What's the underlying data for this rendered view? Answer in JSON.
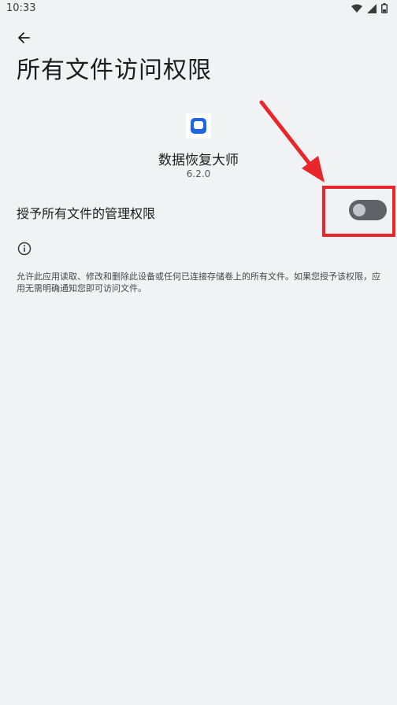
{
  "status_bar": {
    "time": "10:33"
  },
  "header": {
    "title": "所有文件访问权限"
  },
  "app": {
    "name": "数据恢复大师",
    "version": "6.2.0"
  },
  "permission": {
    "label": "授予所有文件的管理权限",
    "enabled": false
  },
  "info": {
    "description": "允许此应用读取、修改和删除此设备或任何已连接存储卷上的所有文件。如果您授予该权限，应用无需明确通知您即可访问文件。"
  },
  "colors": {
    "background": "#f1f2f4",
    "toggle_track_off": "#5f6368",
    "annotation_red": "#e8262b",
    "app_icon_blue": "#1f66e0"
  },
  "icons": {
    "back": "arrow-back-icon",
    "info": "info-icon",
    "wifi": "wifi-icon",
    "signal": "signal-icon",
    "battery": "battery-icon"
  }
}
